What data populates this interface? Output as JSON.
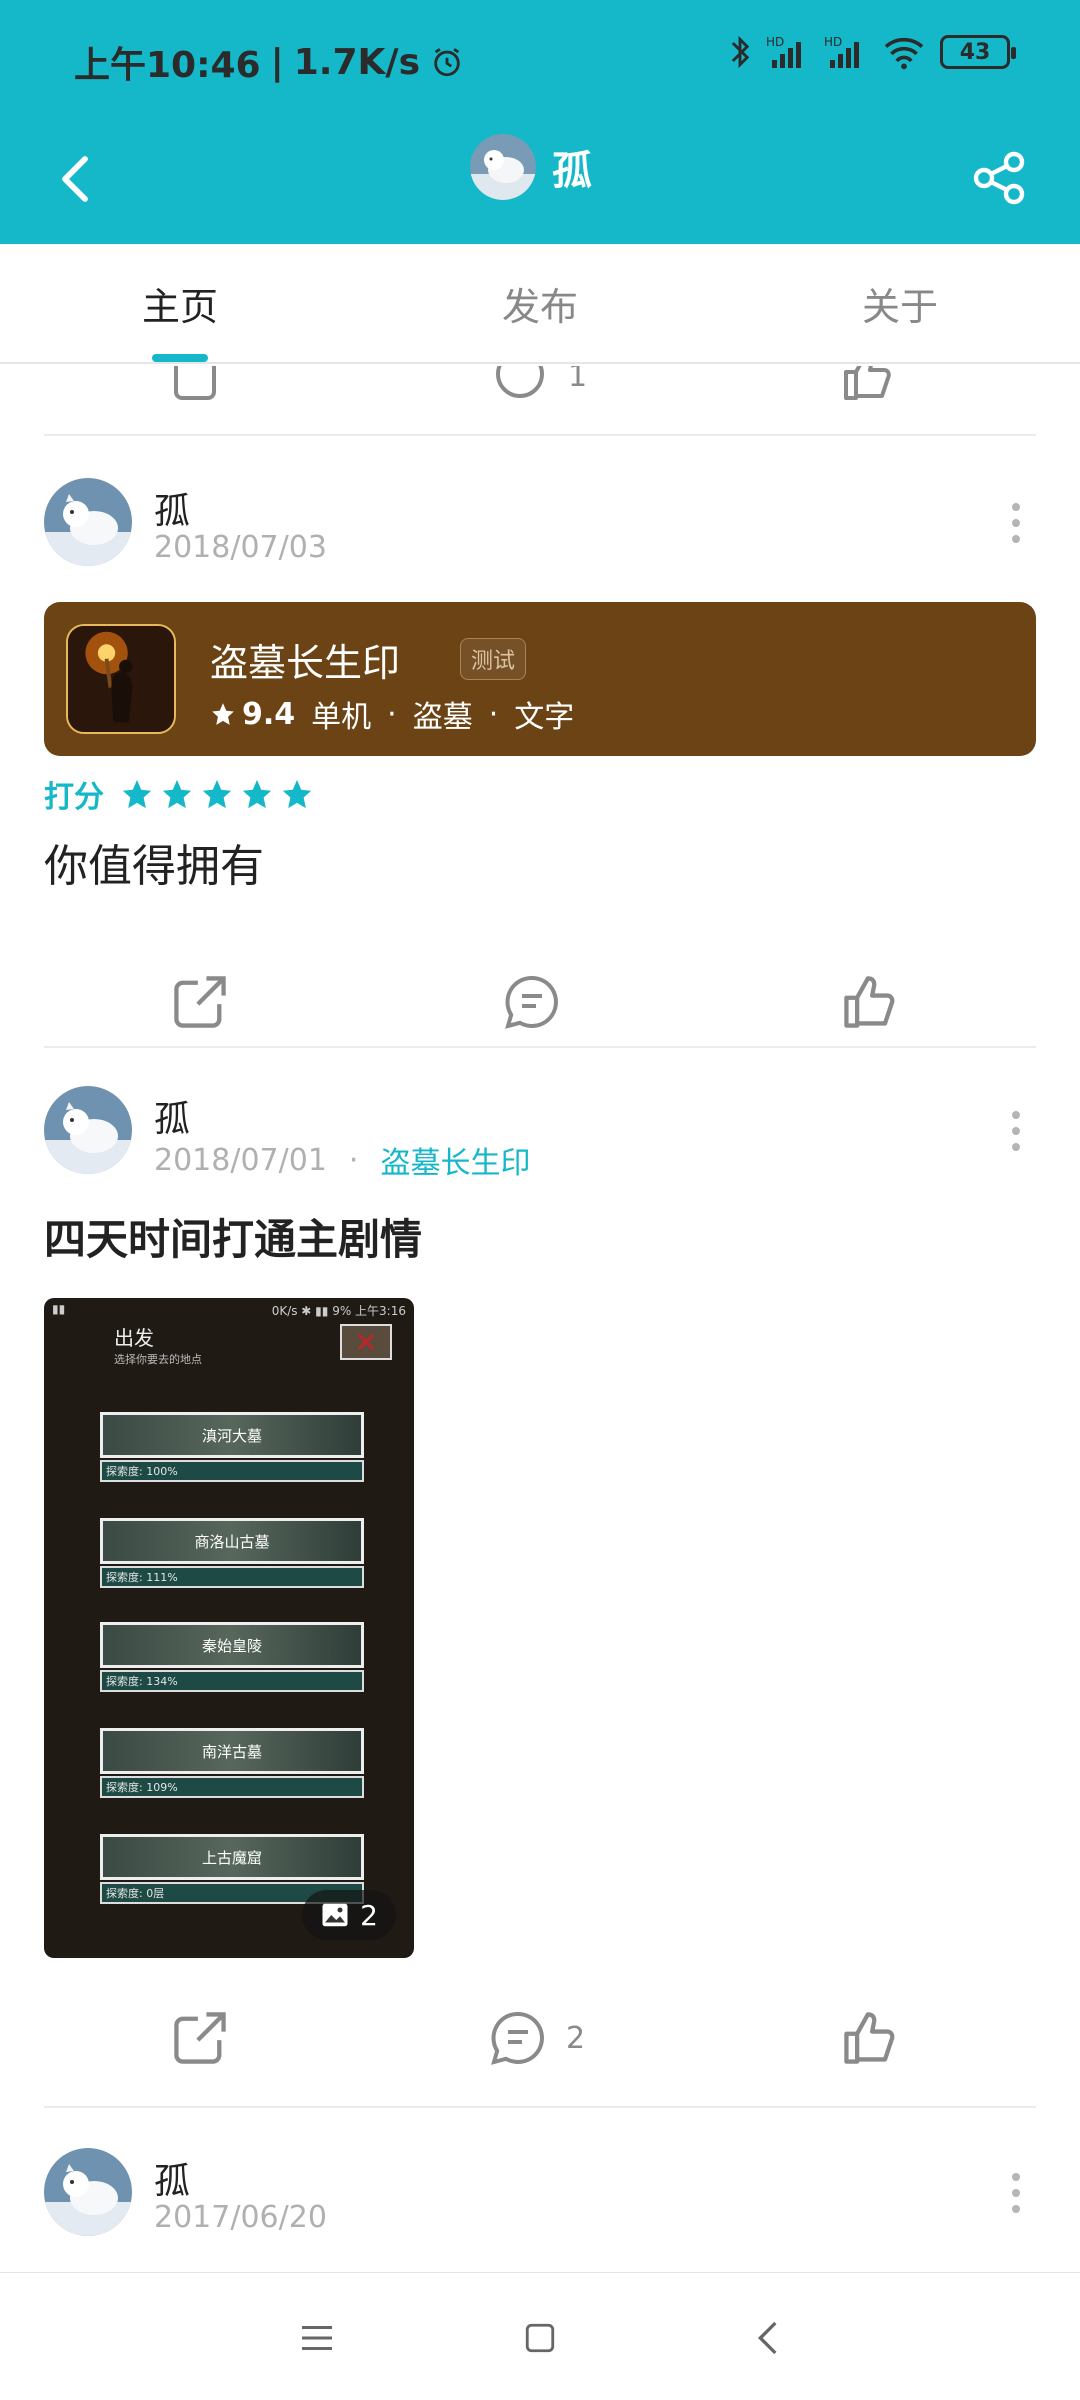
{
  "status_bar": {
    "time": "上午10:46",
    "speed": "1.7K/s",
    "battery": "43"
  },
  "app_bar": {
    "title": "孤"
  },
  "tabs": [
    {
      "label": "主页",
      "active": true
    },
    {
      "label": "发布",
      "active": false
    },
    {
      "label": "关于",
      "active": false
    }
  ],
  "partial_actions": {
    "comment_count": "1"
  },
  "posts": [
    {
      "username": "孤",
      "date": "2018/07/03",
      "game": {
        "name": "盗墓长生印",
        "tag": "测试",
        "rating": "9.4",
        "genres": [
          "单机",
          "盗墓",
          "文字"
        ]
      },
      "rating_label": "打分",
      "stars": 5,
      "text": "你值得拥有",
      "comment_count": ""
    },
    {
      "username": "孤",
      "date": "2018/07/01",
      "game_link": "盗墓长生印",
      "title": "四天时间打通主剧情",
      "image": {
        "status_right": "0K/s ✱ ▮▮ 9% 上午3:16",
        "header_title": "出发",
        "header_sub": "选择你要去的地点",
        "locations": [
          {
            "name": "滇河大墓",
            "progress": "探索度: 100%"
          },
          {
            "name": "商洛山古墓",
            "progress": "探索度: 111%"
          },
          {
            "name": "秦始皇陵",
            "progress": "探索度: 134%"
          },
          {
            "name": "南洋古墓",
            "progress": "探索度: 109%"
          },
          {
            "name": "上古魔窟",
            "progress": "探索度: 0层"
          }
        ],
        "count": "2"
      },
      "comment_count": "2"
    },
    {
      "username": "孤",
      "date": "2017/06/20"
    }
  ],
  "colors": {
    "accent": "#15b8c8",
    "card_brown": "#6b4315"
  }
}
